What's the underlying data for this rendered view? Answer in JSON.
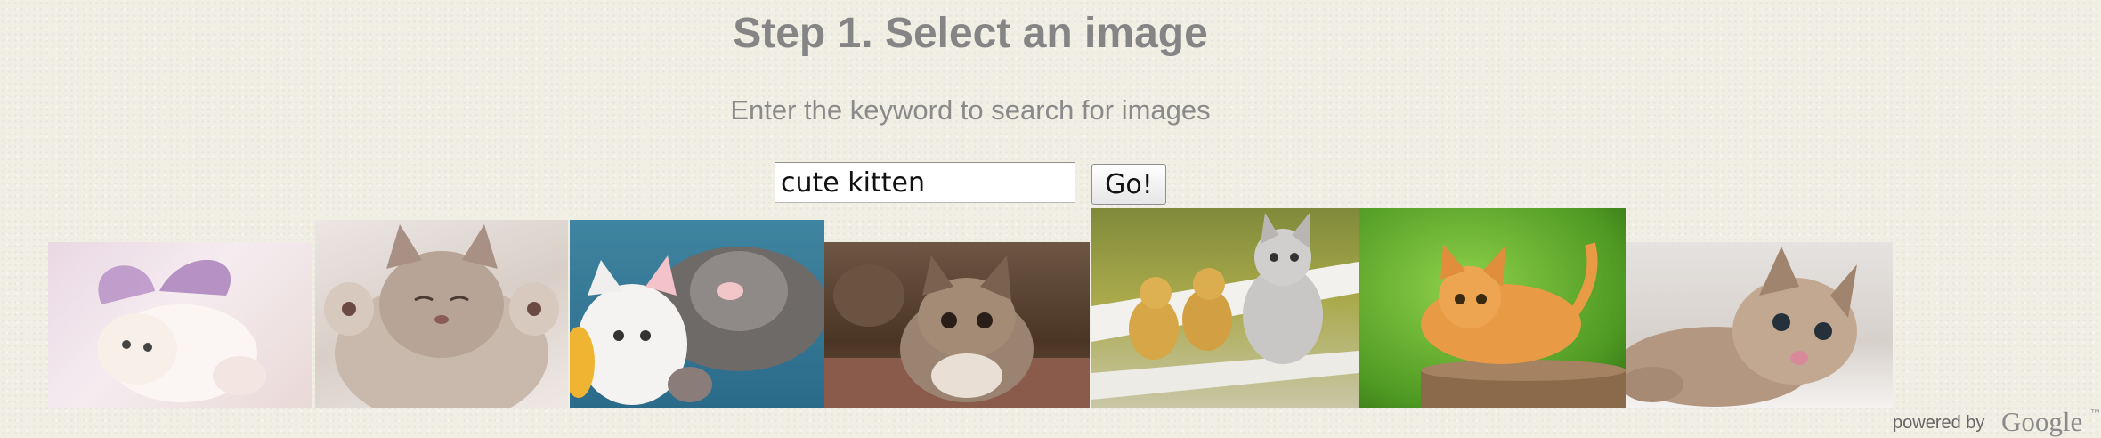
{
  "heading": "Step 1. Select an image",
  "subheading": "Enter the keyword to search for images",
  "search": {
    "value": "cute kitten"
  },
  "go_label": "Go!",
  "results": [
    {
      "icon": "kitten-with-butterfly-wings-image"
    },
    {
      "icon": "kitten-sleeping-paws-up-image"
    },
    {
      "icon": "kitten-with-plush-toy-image"
    },
    {
      "icon": "tabby-kitten-on-rug-image"
    },
    {
      "icon": "kitten-with-ducklings-on-bench-image"
    },
    {
      "icon": "ginger-kitten-on-stump-image"
    },
    {
      "icon": "tabby-kitten-lying-down-image"
    }
  ],
  "footer": {
    "powered_by": "powered by",
    "brand": "Google",
    "trademark": "™"
  },
  "colors": {
    "background": "#f1eee4",
    "heading": "#858585",
    "subheading": "#8a8a8a"
  }
}
